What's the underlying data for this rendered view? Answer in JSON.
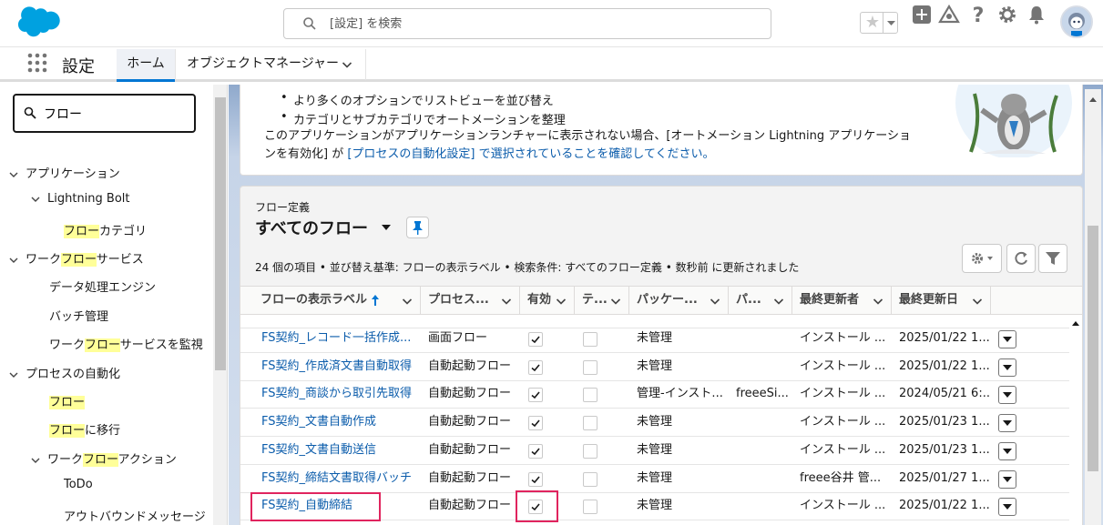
{
  "header": {
    "search_placeholder": "[設定] を検索"
  },
  "context_bar": {
    "app_name": "設定",
    "tab_home": "ホーム",
    "tab_object_manager": "オブジェクトマネージャー"
  },
  "sidebar": {
    "quickfind_value": "フロー",
    "tree": [
      {
        "pre": "",
        "hl": "",
        "post": "アプリケーション"
      },
      {
        "pre": "",
        "hl": "",
        "post": "Lightning Bolt"
      },
      {
        "pre": "",
        "hl": "フロー",
        "post": "カテゴリ"
      },
      {
        "pre": "ワーク",
        "hl": "フロー",
        "post": "サービス"
      },
      {
        "pre": "",
        "hl": "",
        "post": "データ処理エンジン"
      },
      {
        "pre": "",
        "hl": "",
        "post": "バッチ管理"
      },
      {
        "pre": "ワーク",
        "hl": "フロー",
        "post": "サービスを監視"
      },
      {
        "pre": "",
        "hl": "",
        "post": "プロセスの自動化"
      },
      {
        "pre": "",
        "hl": "フロー",
        "post": ""
      },
      {
        "pre": "",
        "hl": "フロー",
        "post": "に移行"
      },
      {
        "pre": "ワーク",
        "hl": "フロー",
        "post": "アクション"
      },
      {
        "pre": "",
        "hl": "",
        "post": "ToDo"
      },
      {
        "pre": "",
        "hl": "",
        "post": "アウトバウンドメッセージ"
      }
    ]
  },
  "intro": {
    "bullet_1": "より多くのオプションでリストビューを並び替え",
    "bullet_2": "カテゴリとサブカテゴリでオートメーションを整理",
    "desc_line_1": "このアプリケーションがアプリケーションランチャーに表示されない場合、[オートメーション Lightning アプリケーショ",
    "desc_line_2_pre": "ンを有効化] が ",
    "desc_line_2_link": "[プロセスの自動化設定] で選択されていることを確認してください。"
  },
  "list": {
    "eyebrow": "フロー定義",
    "title": "すべてのフロー",
    "meta": "24 個の項目 • 並び替え基準: フローの表示ラベル • 検索条件: すべてのフロー定義 • 数秒前 に更新されました",
    "columns": [
      "フローの表示ラベル",
      "プロセス...",
      "有効",
      "テ...",
      "パッケー...",
      "パ...",
      "最終更新者",
      "最終更新日"
    ],
    "rows": [
      {
        "label": "FS契約_レコード一括作成...",
        "process": "画面フロー",
        "active": true,
        "test": false,
        "package": "未管理",
        "pkg2": "",
        "modified_by": "インストール ...",
        "modified_date": "2025/01/22 1..."
      },
      {
        "label": "FS契約_作成済文書自動取得",
        "process": "自動起動フロー",
        "active": true,
        "test": false,
        "package": "未管理",
        "pkg2": "",
        "modified_by": "インストール ...",
        "modified_date": "2025/01/22 1..."
      },
      {
        "label": "FS契約_商談から取引先取得",
        "process": "自動起動フロー",
        "active": true,
        "test": false,
        "package": "管理-インスト...",
        "pkg2": "freeeSi...",
        "modified_by": "インストール ...",
        "modified_date": "2024/05/21 6:..."
      },
      {
        "label": "FS契約_文書自動作成",
        "process": "自動起動フロー",
        "active": true,
        "test": false,
        "package": "未管理",
        "pkg2": "",
        "modified_by": "インストール ...",
        "modified_date": "2025/01/23 1..."
      },
      {
        "label": "FS契約_文書自動送信",
        "process": "自動起動フロー",
        "active": true,
        "test": false,
        "package": "未管理",
        "pkg2": "",
        "modified_by": "インストール ...",
        "modified_date": "2025/01/23 1..."
      },
      {
        "label": "FS契約_締結文書取得バッチ",
        "process": "自動起動フロー",
        "active": true,
        "test": false,
        "package": "未管理",
        "pkg2": "",
        "modified_by": "freee谷井 管...",
        "modified_date": "2025/01/27 1..."
      },
      {
        "label": "FS契約_自動締結",
        "process": "自動起動フロー",
        "active": true,
        "test": false,
        "package": "未管理",
        "pkg2": "",
        "modified_by": "インストール ...",
        "modified_date": "2025/01/22 1..."
      }
    ]
  },
  "colors": {
    "brand": "#0176d3",
    "link": "#0b5cab",
    "highlight": "#e0245e",
    "search_highlight": "#ffff99"
  }
}
